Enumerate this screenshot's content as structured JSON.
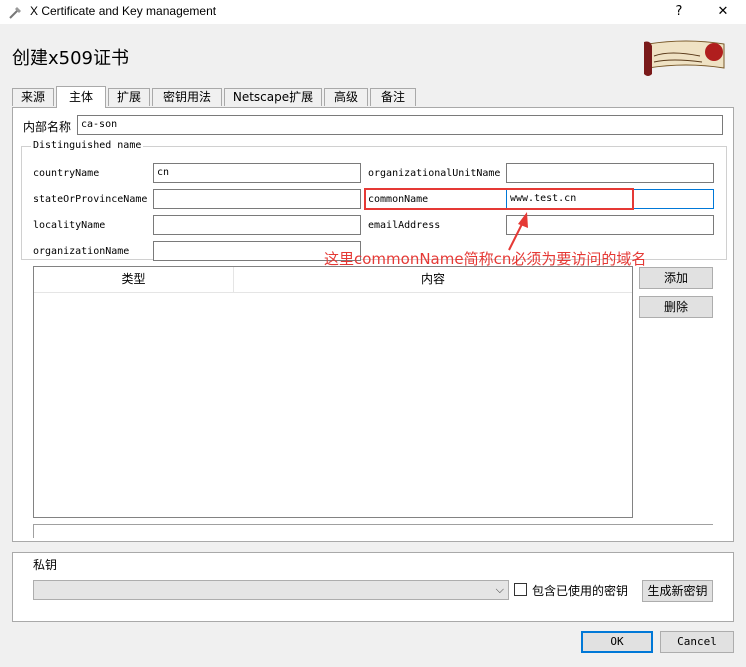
{
  "window": {
    "title": "X Certificate and Key management",
    "help_label": "?",
    "close_label": "✕"
  },
  "dialog": {
    "heading": "创建x509证书"
  },
  "tabs": [
    {
      "label": "来源"
    },
    {
      "label": "主体"
    },
    {
      "label": "扩展"
    },
    {
      "label": "密钥用法"
    },
    {
      "label": "Netscape扩展"
    },
    {
      "label": "高级"
    },
    {
      "label": "备注"
    }
  ],
  "subject": {
    "internal_name_label": "内部名称",
    "internal_name_value": "ca-son",
    "dn_group_title": "Distinguished name",
    "fields": {
      "countryName": {
        "label": "countryName",
        "value": "cn"
      },
      "organizationalUnitName": {
        "label": "organizationalUnitName",
        "value": ""
      },
      "stateOrProvinceName": {
        "label": "stateOrProvinceName",
        "value": ""
      },
      "commonName": {
        "label": "commonName",
        "value": "www.test.cn"
      },
      "localityName": {
        "label": "localityName",
        "value": ""
      },
      "emailAddress": {
        "label": "emailAddress",
        "value": ""
      },
      "organizationName": {
        "label": "organizationName",
        "value": ""
      }
    },
    "table_headers": [
      "类型",
      "内容"
    ],
    "add_button": "添加",
    "delete_button": "删除"
  },
  "annotation": {
    "text": "这里commonName简称cn必须为要访问的域名",
    "color": "#e53935"
  },
  "private_key": {
    "group_title": "私钥",
    "selected_value": "",
    "include_used_label": "包含已使用的密钥",
    "generate_button": "生成新密钥"
  },
  "footer": {
    "ok": "OK",
    "cancel": "Cancel"
  }
}
